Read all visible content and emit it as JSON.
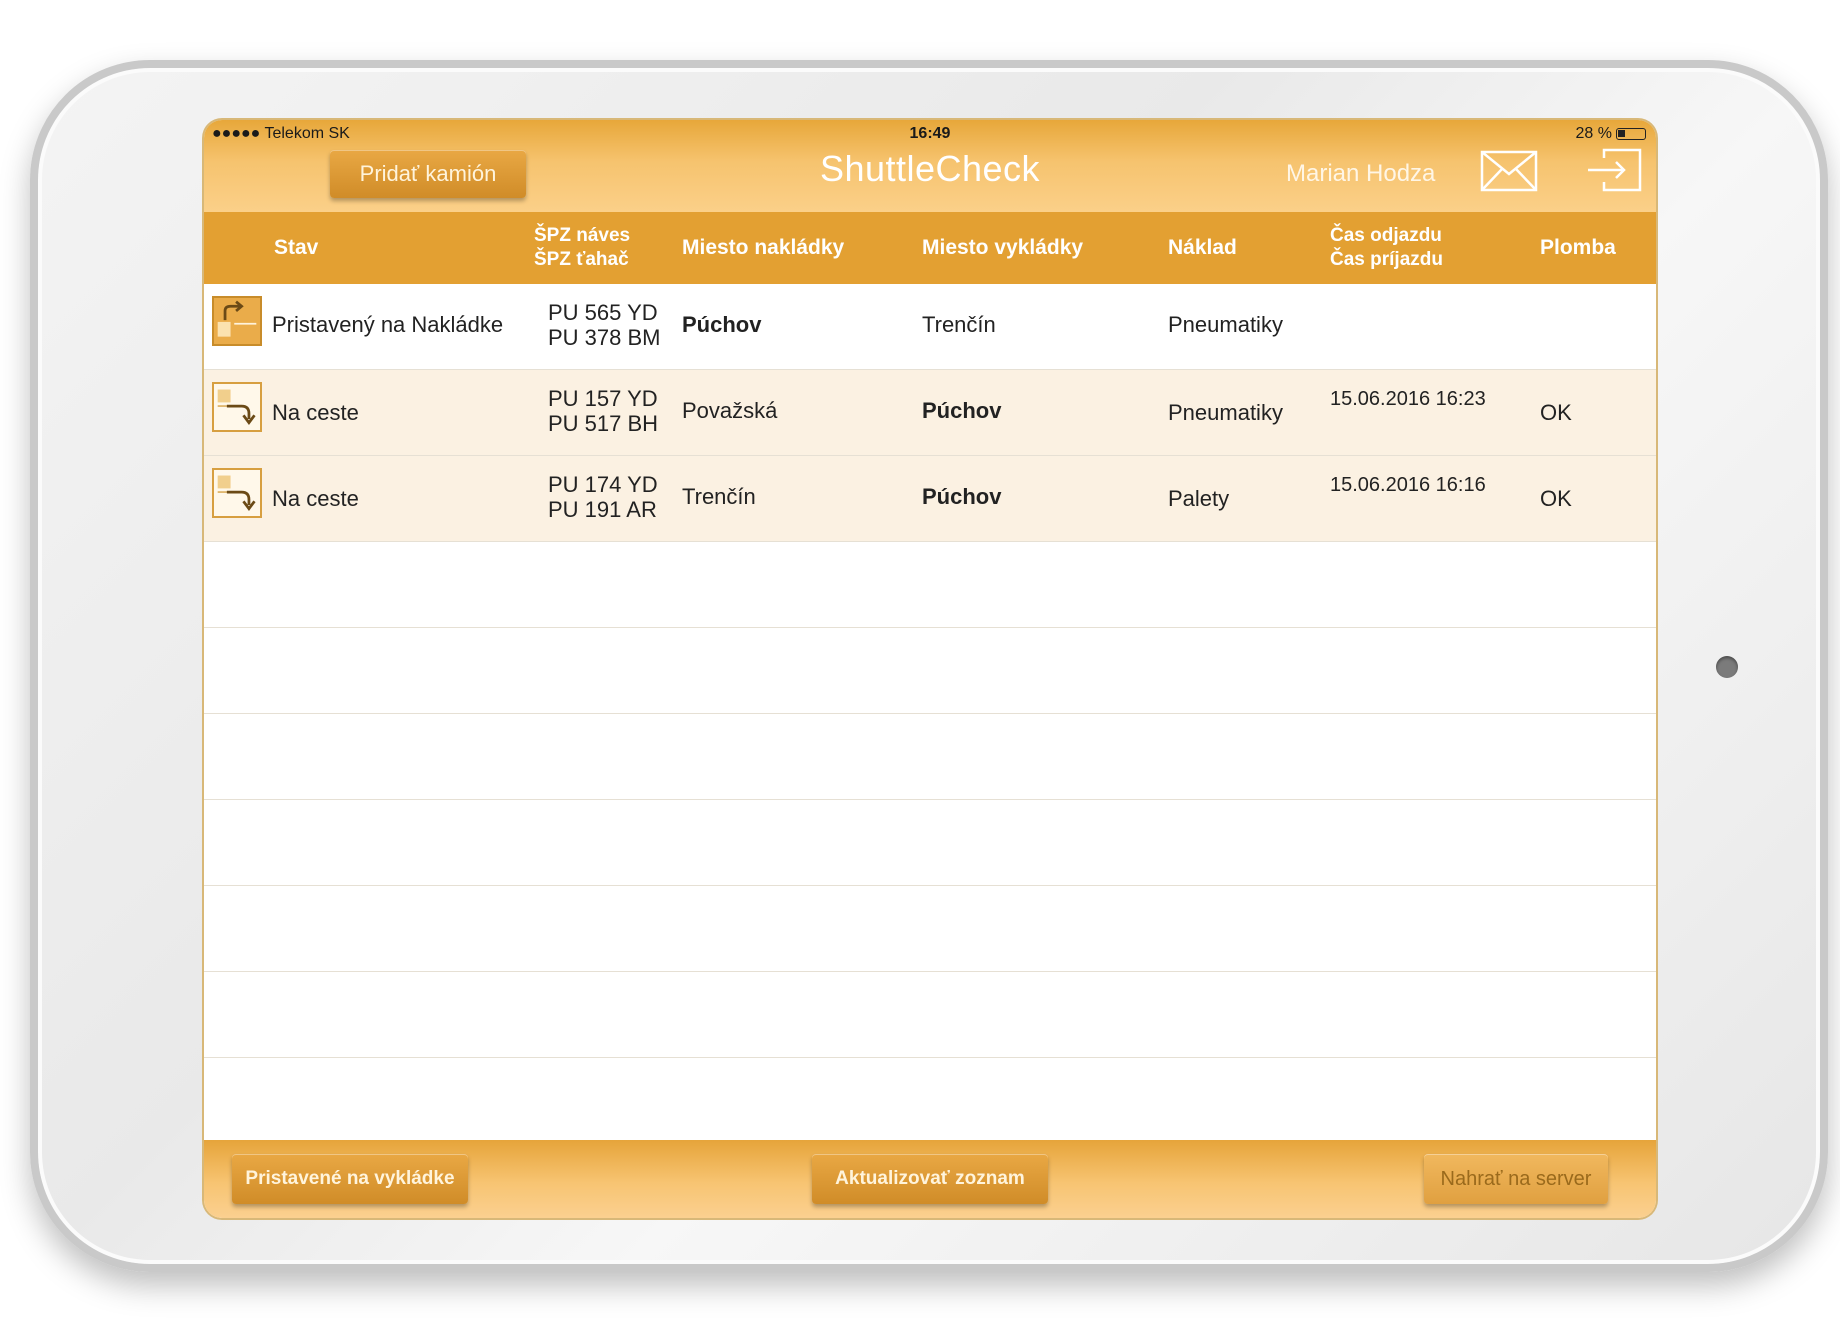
{
  "status_bar": {
    "carrier": "●●●●● Telekom SK",
    "time": "16:49",
    "battery": "28 %"
  },
  "header": {
    "add_truck_label": "Pridať kamión",
    "title": "ShuttleCheck",
    "user": "Marian Hodza",
    "mail_icon": "envelope-icon",
    "logout_icon": "logout-icon"
  },
  "table": {
    "columns": {
      "stav": "Stav",
      "spz_naves": "ŠPZ náves",
      "spz_tahac": "ŠPZ ťahač",
      "miesto_nakladky": "Miesto nakládky",
      "miesto_vykladky": "Miesto vykládky",
      "naklad": "Náklad",
      "cas_odjazdu": "Čas odjazdu",
      "cas_prijazdu": "Čas príjazdu",
      "plomba": "Plomba"
    },
    "rows": [
      {
        "icon": "loading-dock-icon",
        "stav": "Pristavený na Nakládke",
        "spz_naves": "PU 565 YD",
        "spz_tahac": "PU 378 BM",
        "miesto_nakladky": "Púchov",
        "miesto_vykladky": "Trenčín",
        "naklad": "Pneumatiky",
        "cas": "",
        "plomba": ""
      },
      {
        "icon": "in-transit-icon",
        "stav": "Na ceste",
        "spz_naves": "PU 157 YD",
        "spz_tahac": "PU 517 BH",
        "miesto_nakladky": "Považská",
        "miesto_vykladky": "Púchov",
        "naklad": "Pneumatiky",
        "cas": "15.06.2016 16:23",
        "plomba": "OK"
      },
      {
        "icon": "in-transit-icon",
        "stav": "Na ceste",
        "spz_naves": "PU 174 YD",
        "spz_tahac": "PU 191 AR",
        "miesto_nakladky": "Trenčín",
        "miesto_vykladky": "Púchov",
        "naklad": "Palety",
        "cas": "15.06.2016 16:16",
        "plomba": "OK"
      }
    ]
  },
  "footer": {
    "btn_unloading": "Pristavené na vykládke",
    "btn_refresh": "Aktualizovať zoznam",
    "btn_upload": "Nahrať na server"
  },
  "colors": {
    "accent": "#e3a032",
    "row_alt": "#fbf1e2"
  }
}
